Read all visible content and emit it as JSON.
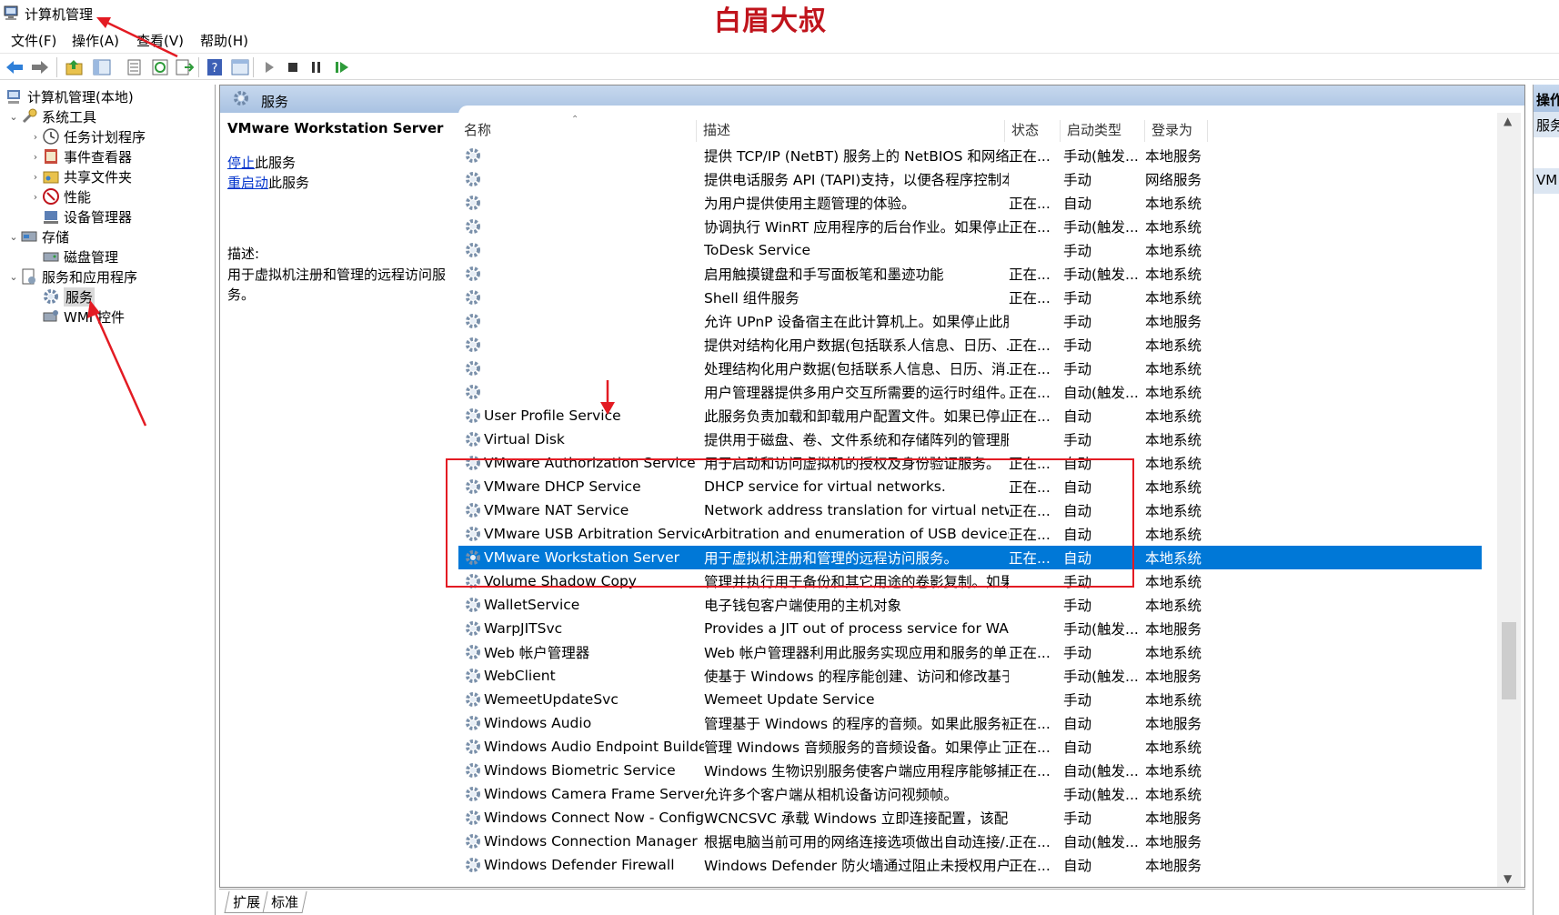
{
  "window": {
    "title": "计算机管理",
    "watermark": "白眉大叔"
  },
  "menu": [
    "文件(F)",
    "操作(A)",
    "查看(V)",
    "帮助(H)"
  ],
  "toolbar_icons": [
    "back-arrow-icon",
    "forward-arrow-icon",
    "up-folder-icon",
    "show-hide-tree-icon",
    "properties-icon",
    "refresh-icon",
    "export-list-icon",
    "help-icon",
    "view-icon",
    "play-icon",
    "stop-icon",
    "pause-icon",
    "resume-icon"
  ],
  "tree": {
    "root": "计算机管理(本地)",
    "system_tools": "系统工具",
    "task_scheduler": "任务计划程序",
    "event_viewer": "事件查看器",
    "shared_folders": "共享文件夹",
    "performance": "性能",
    "device_manager": "设备管理器",
    "storage": "存储",
    "disk_management": "磁盘管理",
    "services_apps": "服务和应用程序",
    "services": "服务",
    "wmi": "WMI 控件"
  },
  "panel": {
    "header": "服务"
  },
  "extended": {
    "service_name": "VMware Workstation Server",
    "stop_link": "停止",
    "stop_suffix": "此服务",
    "restart_link": "重启动",
    "restart_suffix": "此服务",
    "desc_label": "描述:",
    "description": "用于虚拟机注册和管理的远程访问服务。"
  },
  "columns": {
    "name": "名称",
    "desc": "描述",
    "status": "状态",
    "startup": "启动类型",
    "logon": "登录为"
  },
  "rows": [
    {
      "name": "",
      "desc": "提供 TCP/IP (NetBT) 服务上的 NetBIOS 和网络上...",
      "status": "正在...",
      "startup": "手动(触发...",
      "logon": "本地服务"
    },
    {
      "name": "",
      "desc": "提供电话服务 API (TAPI)支持，以便各程序控制本...",
      "status": "",
      "startup": "手动",
      "logon": "网络服务"
    },
    {
      "name": "",
      "desc": "为用户提供使用主题管理的体验。",
      "status": "正在...",
      "startup": "自动",
      "logon": "本地系统"
    },
    {
      "name": "",
      "desc": "协调执行 WinRT 应用程序的后台作业。如果停止...",
      "status": "正在...",
      "startup": "手动(触发...",
      "logon": "本地系统"
    },
    {
      "name": "",
      "desc": "ToDesk Service",
      "status": "",
      "startup": "手动",
      "logon": "本地系统"
    },
    {
      "name": "",
      "desc": "启用触摸键盘和手写面板笔和墨迹功能",
      "status": "正在...",
      "startup": "手动(触发...",
      "logon": "本地系统"
    },
    {
      "name": "",
      "desc": "Shell 组件服务",
      "status": "正在...",
      "startup": "手动",
      "logon": "本地系统"
    },
    {
      "name": "",
      "desc": "允许 UPnP 设备宿主在此计算机上。如果停止此服...",
      "status": "",
      "startup": "手动",
      "logon": "本地服务"
    },
    {
      "name": "",
      "desc": "提供对结构化用户数据(包括联系人信息、日历、...",
      "status": "正在...",
      "startup": "手动",
      "logon": "本地系统"
    },
    {
      "name": "",
      "desc": "处理结构化用户数据(包括联系人信息、日历、消...",
      "status": "正在...",
      "startup": "手动",
      "logon": "本地系统"
    },
    {
      "name": "",
      "desc": "用户管理器提供多用户交互所需要的运行时组件。...",
      "status": "正在...",
      "startup": "自动(触发...",
      "logon": "本地系统"
    },
    {
      "name": "User Profile Service",
      "desc": "此服务负责加载和卸载用户配置文件。如果已停止...",
      "status": "正在...",
      "startup": "自动",
      "logon": "本地系统"
    },
    {
      "name": "Virtual Disk",
      "desc": "提供用于磁盘、卷、文件系统和存储阵列的管理服...",
      "status": "",
      "startup": "手动",
      "logon": "本地系统"
    },
    {
      "name": "VMware Authorization Service",
      "desc": "用于启动和访问虚拟机的授权及身份验证服务。",
      "status": "正在...",
      "startup": "自动",
      "logon": "本地系统"
    },
    {
      "name": "VMware DHCP Service",
      "desc": "DHCP service for virtual networks.",
      "status": "正在...",
      "startup": "自动",
      "logon": "本地系统"
    },
    {
      "name": "VMware NAT Service",
      "desc": "Network address translation for virtual networks.",
      "status": "正在...",
      "startup": "自动",
      "logon": "本地系统"
    },
    {
      "name": "VMware USB Arbitration Service",
      "desc": "Arbitration and enumeration of USB devices for vi...",
      "status": "正在...",
      "startup": "自动",
      "logon": "本地系统"
    },
    {
      "name": "VMware Workstation Server",
      "desc": "用于虚拟机注册和管理的远程访问服务。",
      "status": "正在...",
      "startup": "自动",
      "logon": "本地系统",
      "selected": true
    },
    {
      "name": "Volume Shadow Copy",
      "desc": "管理并执行用于备份和其它用途的卷影复制。如果...",
      "status": "",
      "startup": "手动",
      "logon": "本地系统"
    },
    {
      "name": "WalletService",
      "desc": "电子钱包客户端使用的主机对象",
      "status": "",
      "startup": "手动",
      "logon": "本地系统"
    },
    {
      "name": "WarpJITSvc",
      "desc": "Provides a JIT out of process service for WARP w...",
      "status": "",
      "startup": "手动(触发...",
      "logon": "本地服务"
    },
    {
      "name": "Web 帐户管理器",
      "desc": "Web 帐户管理器利用此服务实现应用和服务的单...",
      "status": "正在...",
      "startup": "手动",
      "logon": "本地系统"
    },
    {
      "name": "WebClient",
      "desc": "使基于 Windows 的程序能创建、访问和修改基于 I...",
      "status": "",
      "startup": "手动(触发...",
      "logon": "本地服务"
    },
    {
      "name": "WemeetUpdateSvc",
      "desc": "Wemeet Update Service",
      "status": "",
      "startup": "手动",
      "logon": "本地系统"
    },
    {
      "name": "Windows Audio",
      "desc": "管理基于 Windows 的程序的音频。如果此服务被...",
      "status": "正在...",
      "startup": "自动",
      "logon": "本地服务"
    },
    {
      "name": "Windows Audio Endpoint Builder",
      "desc": "管理 Windows 音频服务的音频设备。如果停止了...",
      "status": "正在...",
      "startup": "自动",
      "logon": "本地系统"
    },
    {
      "name": "Windows Biometric Service",
      "desc": "Windows 生物识别服务使客户端应用程序能够捕...",
      "status": "正在...",
      "startup": "自动(触发...",
      "logon": "本地系统"
    },
    {
      "name": "Windows Camera Frame Server",
      "desc": "允许多个客户端从相机设备访问视频帧。",
      "status": "",
      "startup": "手动(触发...",
      "logon": "本地系统"
    },
    {
      "name": "Windows Connect Now - Config Re...",
      "desc": "WCNCSVC 承载 Windows 立即连接配置，该配置...",
      "status": "",
      "startup": "手动",
      "logon": "本地服务"
    },
    {
      "name": "Windows Connection Manager",
      "desc": "根据电脑当前可用的网络连接选项做出自动连接/...",
      "status": "正在...",
      "startup": "自动(触发...",
      "logon": "本地服务"
    },
    {
      "name": "Windows Defender Firewall",
      "desc": "Windows Defender 防火墙通过阻止未授权用户通...",
      "status": "正在...",
      "startup": "自动",
      "logon": "本地服务"
    }
  ],
  "bottom_tabs": {
    "extended": "扩展",
    "standard": "标准"
  },
  "actions": {
    "header": "操作",
    "item1": "服务",
    "item2": "VM"
  },
  "colors": {
    "selection": "#0078d7",
    "annotation": "#e31b23",
    "header_gradient": "#b8cde8"
  }
}
